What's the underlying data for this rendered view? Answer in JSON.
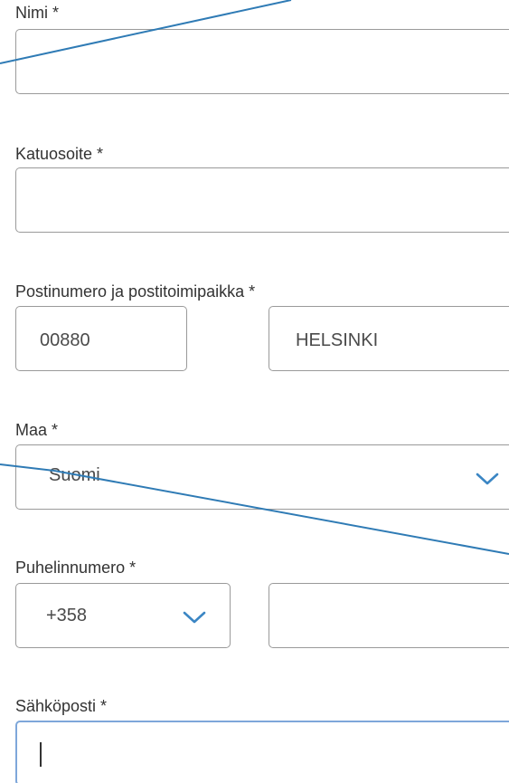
{
  "form": {
    "name_label": "Nimi *",
    "name_value": "",
    "street_label": "Katuosoite *",
    "street_value": "",
    "postal_label": "Postinumero ja postitoimipaikka *",
    "postal_code": "00880",
    "city": "HELSINKI",
    "country_label": "Maa *",
    "country_value": "Suomi",
    "phone_label": "Puhelinnumero *",
    "phone_prefix": "+358",
    "phone_value": "",
    "email_label": "Sähköposti *",
    "email_value": ""
  },
  "colors": {
    "chevron": "#3b86c4",
    "focus_border": "#7ea7da",
    "annotation_line": "#2f7bb5"
  },
  "icons": {
    "dropdown": "chevron-down-icon"
  }
}
